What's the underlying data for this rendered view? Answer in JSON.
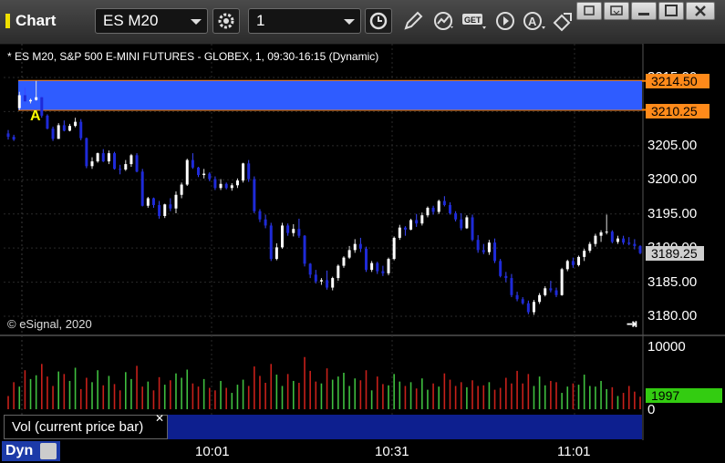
{
  "toolbar": {
    "title": "Chart",
    "symbol": "ES M20",
    "interval": "1"
  },
  "chart": {
    "info_line": "* ES M20, S&P 500 E-MINI FUTURES - GLOBEX, 1, 09:30-16:15 (Dynamic)",
    "copyright": "© eSignal, 2020",
    "marker_label": "A",
    "price_axis": [
      "3215.00",
      "3210.00",
      "3205.00",
      "3200.00",
      "3195.00",
      "3190.00",
      "3185.00",
      "3180.00"
    ],
    "price_tags": {
      "upper": "3214.50",
      "lower": "3210.25",
      "last": "3189.25"
    },
    "volume_axis": [
      "10000",
      "0"
    ],
    "volume_last": "1997",
    "volume_study_label": "Vol (current price bar)",
    "time_axis": [
      "10:01",
      "10:31",
      "11:01"
    ],
    "bottom_label": "Dyn",
    "colors": {
      "up_candle": "#ffffff",
      "down_candle": "#1e2ad8",
      "zone_fill": "#2f5cff",
      "zone_line": "#ff7f00",
      "vol_up": "#3fbf3f",
      "vol_down": "#c8201a"
    }
  },
  "chart_data": {
    "type": "candlestick",
    "price_range": [
      3178,
      3217
    ],
    "zone": [
      3210.25,
      3214.5
    ],
    "last_price": 3189.25,
    "candles": [
      [
        3206.8,
        3207.3,
        3205.9,
        3206.3
      ],
      [
        3206.3,
        3206.6,
        3205.7,
        3205.9
      ],
      [
        3210.5,
        3212.9,
        3210.2,
        3212.4
      ],
      [
        3212.4,
        3213.5,
        3211.4,
        3211.5
      ],
      [
        3211.5,
        3211.9,
        3211.2,
        3211.7
      ],
      [
        3211.7,
        3214.5,
        3211.6,
        3212.1
      ],
      [
        3212.1,
        3212.2,
        3209.1,
        3209.4
      ],
      [
        3209.4,
        3209.6,
        3207.4,
        3207.5
      ],
      [
        3207.5,
        3207.8,
        3205.7,
        3206.0
      ],
      [
        3206.0,
        3208.3,
        3206.0,
        3208.0
      ],
      [
        3208.0,
        3208.7,
        3207.1,
        3207.2
      ],
      [
        3207.2,
        3208.2,
        3207.1,
        3207.9
      ],
      [
        3207.9,
        3209.1,
        3207.7,
        3208.5
      ],
      [
        3208.5,
        3208.9,
        3205.8,
        3206.1
      ],
      [
        3206.1,
        3206.2,
        3201.7,
        3202.0
      ],
      [
        3202.0,
        3203.3,
        3201.6,
        3202.7
      ],
      [
        3202.7,
        3204.0,
        3202.5,
        3203.9
      ],
      [
        3203.9,
        3204.5,
        3202.6,
        3202.7
      ],
      [
        3202.7,
        3204.3,
        3202.3,
        3203.9
      ],
      [
        3203.9,
        3204.1,
        3201.5,
        3201.6
      ],
      [
        3201.6,
        3202.2,
        3200.8,
        3201.5
      ],
      [
        3201.5,
        3202.9,
        3201.3,
        3202.3
      ],
      [
        3202.3,
        3203.8,
        3201.9,
        3203.6
      ],
      [
        3203.6,
        3203.9,
        3201.1,
        3201.2
      ],
      [
        3201.2,
        3201.6,
        3196.1,
        3196.2
      ],
      [
        3196.2,
        3197.5,
        3195.9,
        3197.3
      ],
      [
        3197.3,
        3197.4,
        3195.9,
        3196.3
      ],
      [
        3196.3,
        3196.9,
        3194.3,
        3194.7
      ],
      [
        3194.7,
        3196.5,
        3194.4,
        3196.4
      ],
      [
        3196.4,
        3197.3,
        3195.4,
        3195.8
      ],
      [
        3195.8,
        3198.3,
        3195.1,
        3197.8
      ],
      [
        3197.8,
        3199.6,
        3197.3,
        3199.3
      ],
      [
        3199.3,
        3203.1,
        3199.1,
        3202.9
      ],
      [
        3202.9,
        3203.9,
        3201.6,
        3201.8
      ],
      [
        3201.8,
        3201.9,
        3200.4,
        3200.7
      ],
      [
        3200.7,
        3201.6,
        3200.2,
        3200.9
      ],
      [
        3200.9,
        3201.1,
        3199.8,
        3200.1
      ],
      [
        3200.1,
        3200.5,
        3198.5,
        3198.8
      ],
      [
        3198.8,
        3200.1,
        3198.5,
        3199.4
      ],
      [
        3199.4,
        3199.6,
        3198.6,
        3198.8
      ],
      [
        3198.8,
        3199.5,
        3198.4,
        3199.2
      ],
      [
        3199.2,
        3200.2,
        3198.8,
        3199.9
      ],
      [
        3199.9,
        3202.5,
        3199.6,
        3202.4
      ],
      [
        3202.4,
        3202.9,
        3199.7,
        3200.1
      ],
      [
        3200.1,
        3200.5,
        3195.1,
        3195.4
      ],
      [
        3195.4,
        3195.7,
        3193.8,
        3194.2
      ],
      [
        3194.2,
        3194.9,
        3192.9,
        3193.3
      ],
      [
        3193.3,
        3193.7,
        3188.1,
        3188.4
      ],
      [
        3188.4,
        3190.7,
        3188.2,
        3190.1
      ],
      [
        3190.1,
        3193.7,
        3189.9,
        3193.3
      ],
      [
        3193.3,
        3193.6,
        3191.8,
        3192.2
      ],
      [
        3192.2,
        3193.5,
        3191.7,
        3192.8
      ],
      [
        3192.8,
        3194.3,
        3191.5,
        3191.8
      ],
      [
        3191.8,
        3191.9,
        3187.3,
        3187.7
      ],
      [
        3187.7,
        3187.8,
        3185.6,
        3186.1
      ],
      [
        3186.1,
        3186.8,
        3184.8,
        3185.1
      ],
      [
        3185.1,
        3185.6,
        3184.6,
        3185.3
      ],
      [
        3185.3,
        3186.7,
        3183.9,
        3184.2
      ],
      [
        3184.2,
        3185.8,
        3183.8,
        3185.6
      ],
      [
        3185.6,
        3187.6,
        3185.2,
        3187.4
      ],
      [
        3187.4,
        3188.8,
        3187.1,
        3188.6
      ],
      [
        3188.6,
        3190.3,
        3188.4,
        3189.7
      ],
      [
        3189.7,
        3191.3,
        3189.3,
        3190.6
      ],
      [
        3190.6,
        3191.5,
        3189.4,
        3189.9
      ],
      [
        3189.9,
        3190.2,
        3186.5,
        3186.8
      ],
      [
        3186.8,
        3188.1,
        3186.5,
        3187.8
      ],
      [
        3187.8,
        3188.0,
        3186.2,
        3186.6
      ],
      [
        3186.6,
        3187.4,
        3185.9,
        3186.3
      ],
      [
        3186.3,
        3188.6,
        3186.0,
        3188.4
      ],
      [
        3188.4,
        3191.7,
        3188.2,
        3191.5
      ],
      [
        3191.5,
        3193.4,
        3191.2,
        3193.0
      ],
      [
        3193.0,
        3193.2,
        3191.8,
        3192.7
      ],
      [
        3192.7,
        3194.3,
        3192.6,
        3194.1
      ],
      [
        3194.1,
        3195.0,
        3193.1,
        3193.6
      ],
      [
        3193.6,
        3195.2,
        3193.3,
        3194.8
      ],
      [
        3194.8,
        3196.1,
        3194.5,
        3195.9
      ],
      [
        3195.9,
        3196.2,
        3194.9,
        3195.3
      ],
      [
        3195.3,
        3197.1,
        3195.0,
        3196.9
      ],
      [
        3196.9,
        3197.6,
        3196.1,
        3196.3
      ],
      [
        3196.3,
        3196.7,
        3194.9,
        3195.1
      ],
      [
        3195.1,
        3195.4,
        3193.9,
        3194.2
      ],
      [
        3194.2,
        3195.1,
        3192.6,
        3192.9
      ],
      [
        3192.9,
        3194.8,
        3192.8,
        3194.5
      ],
      [
        3194.5,
        3194.9,
        3191.0,
        3191.2
      ],
      [
        3191.2,
        3191.9,
        3189.3,
        3189.7
      ],
      [
        3189.7,
        3190.6,
        3189.1,
        3189.4
      ],
      [
        3189.4,
        3191.2,
        3189.0,
        3190.8
      ],
      [
        3190.8,
        3191.4,
        3187.8,
        3188.1
      ],
      [
        3188.1,
        3188.4,
        3185.7,
        3185.9
      ],
      [
        3185.9,
        3186.5,
        3185.0,
        3185.6
      ],
      [
        3185.6,
        3186.2,
        3182.8,
        3183.1
      ],
      [
        3183.1,
        3183.6,
        3182.2,
        3182.5
      ],
      [
        3182.5,
        3182.8,
        3181.7,
        3181.9
      ],
      [
        3181.9,
        3182.3,
        3180.3,
        3180.6
      ],
      [
        3180.6,
        3182.4,
        3180.2,
        3182.1
      ],
      [
        3182.1,
        3183.4,
        3181.8,
        3183.1
      ],
      [
        3183.1,
        3184.4,
        3182.9,
        3184.1
      ],
      [
        3184.1,
        3185.2,
        3183.5,
        3183.8
      ],
      [
        3183.8,
        3184.2,
        3182.8,
        3183.1
      ],
      [
        3183.1,
        3187.1,
        3183.0,
        3186.9
      ],
      [
        3186.9,
        3188.3,
        3186.6,
        3188.1
      ],
      [
        3188.1,
        3188.6,
        3187.1,
        3187.5
      ],
      [
        3187.5,
        3188.9,
        3187.3,
        3188.7
      ],
      [
        3188.7,
        3189.9,
        3188.1,
        3189.6
      ],
      [
        3189.6,
        3190.9,
        3189.3,
        3190.6
      ],
      [
        3190.6,
        3192.1,
        3190.2,
        3191.8
      ],
      [
        3191.8,
        3192.6,
        3190.9,
        3192.3
      ],
      [
        3192.3,
        3194.9,
        3192.0,
        3192.4
      ],
      [
        3192.4,
        3192.6,
        3190.7,
        3190.9
      ],
      [
        3190.9,
        3191.8,
        3190.6,
        3191.4
      ],
      [
        3191.4,
        3191.8,
        3190.5,
        3190.8
      ],
      [
        3190.8,
        3191.6,
        3190.4,
        3190.6
      ],
      [
        3190.6,
        3191.3,
        3189.8,
        3190.3
      ],
      [
        3190.3,
        3190.4,
        3189.1,
        3189.25
      ]
    ],
    "volume_range": [
      0,
      10000
    ],
    "volume": [
      2100,
      4300,
      3600,
      6200,
      4800,
      5400,
      7200,
      5200,
      3700,
      6000,
      5600,
      4500,
      6600,
      3200,
      5000,
      4300,
      6200,
      3800,
      5300,
      4000,
      3000,
      5900,
      4800,
      6900,
      3600,
      4400,
      3000,
      5100,
      3900,
      4600,
      5700,
      5000,
      6300,
      4100,
      3600,
      4800,
      3400,
      3000,
      4500,
      3400,
      2600,
      3900,
      4700,
      3700,
      6800,
      5300,
      4200,
      7200,
      5500,
      3700,
      5600,
      4500,
      4200,
      8300,
      6100,
      4400,
      4100,
      6500,
      4700,
      5200,
      5800,
      3700,
      4900,
      4600,
      6200,
      3000,
      5200,
      4000,
      3800,
      5600,
      4400,
      3700,
      4300,
      3300,
      4900,
      3100,
      4100,
      3600,
      5700,
      4700,
      3700,
      4300,
      3500,
      4600,
      3700,
      3800,
      4300,
      3100,
      3400,
      5000,
      4100,
      6100,
      4100,
      5600,
      3700,
      5200,
      3800,
      4500,
      4300,
      2600,
      3600,
      4100,
      3900,
      5500,
      3700,
      3600,
      4500,
      3200,
      3500,
      2100,
      2600,
      3700,
      2800,
      1997
    ]
  }
}
